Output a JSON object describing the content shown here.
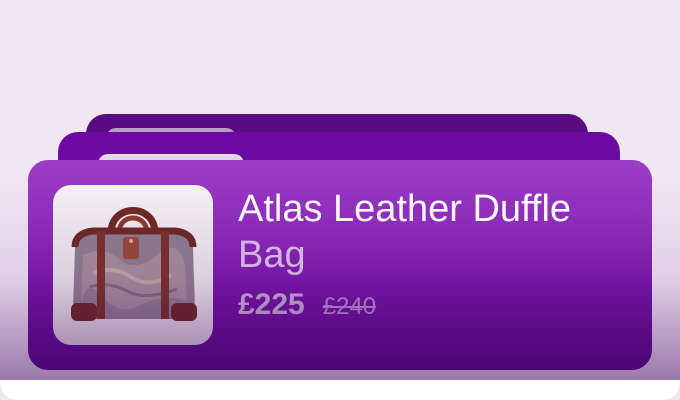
{
  "product": {
    "title_line1": "Atlas Leather Duffle",
    "title_line2": "Bag",
    "price": "£225",
    "old_price": "£240",
    "image_alt": "atlas-leather-duffle-bag-image"
  },
  "colors": {
    "background": "#f1e6f4",
    "card_front_top": "#9b3dc6",
    "card_front_bottom": "#5a0a88",
    "card_back_2": "#6c0aa2",
    "card_back_3": "#5a0a82",
    "title": "#ffffff",
    "price": "#c9afd8",
    "old_price": "#b98fd0"
  }
}
